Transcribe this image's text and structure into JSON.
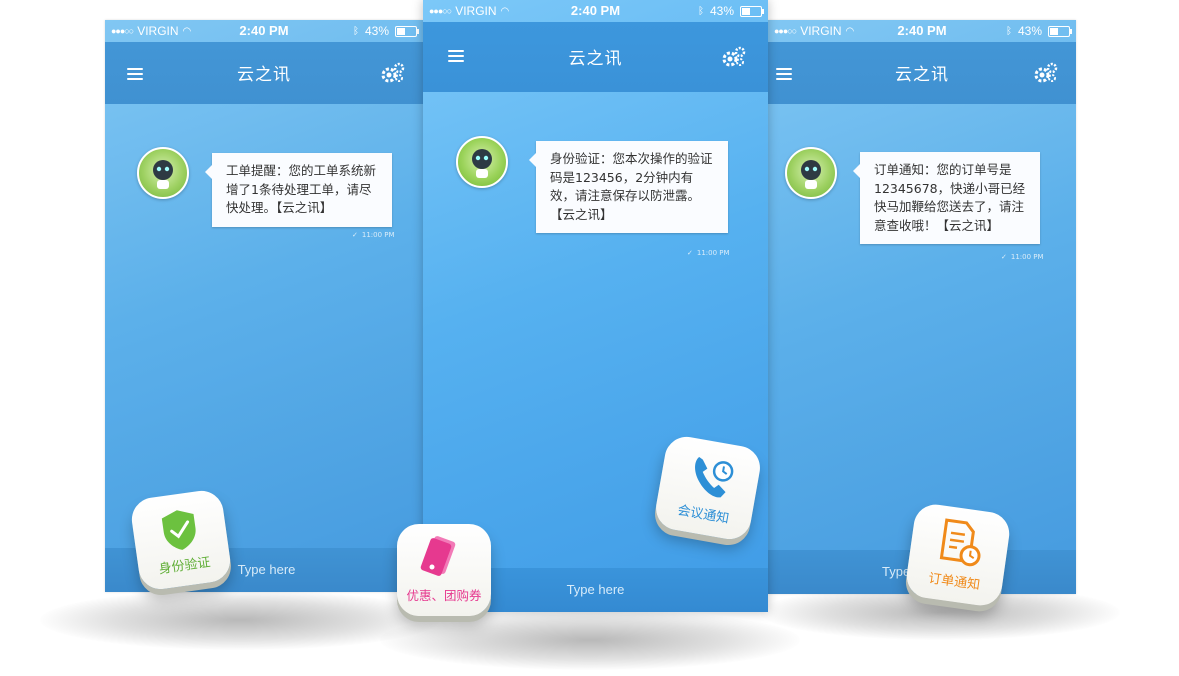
{
  "status": {
    "carrier": "VIRGIN",
    "time": "2:40 PM",
    "battery": "43%"
  },
  "app_title": "云之讯",
  "input_placeholder": "Type here",
  "msg_time": "11:00 PM",
  "phones": {
    "left": {
      "message": "工单提醒：您的工单系统新增了1条待处理工单，请尽快处理。【云之讯】"
    },
    "center": {
      "message": "身份验证：您本次操作的验证码是123456，2分钟内有效，请注意保存以防泄露。【云之讯】"
    },
    "right": {
      "message": "订单通知：您的订单号是12345678，快递小哥已经快马加鞭给您送去了，请注意查收哦！【云之讯】"
    }
  },
  "badges": {
    "identity": "身份验证",
    "coupon": "优惠、团购券",
    "meeting": "会议通知",
    "order": "订单通知"
  },
  "colors": {
    "screen": "#56b1f0",
    "navbar": "#3d97dd",
    "identity": "#6cc13f",
    "coupon": "#e6398f",
    "meeting": "#2d8fd6",
    "order": "#f08a1a"
  }
}
